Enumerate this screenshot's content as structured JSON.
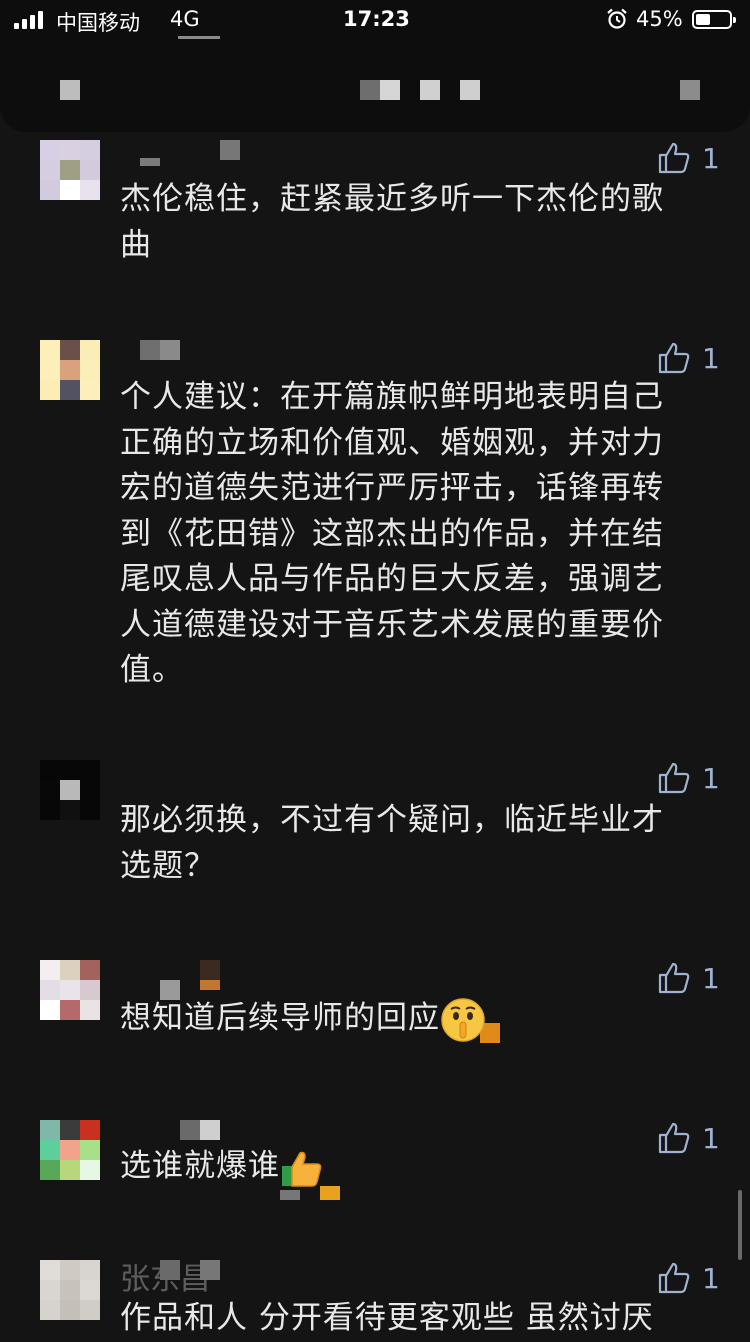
{
  "status_bar": {
    "carrier": "中国移动",
    "network": "4G",
    "time": "17:23",
    "battery_percent": "45%",
    "battery_level": 0.45
  },
  "header": {
    "title": "(pixelated)"
  },
  "comments": [
    {
      "text": "杰伦稳住，赶紧最近多听一下杰伦的歌曲",
      "likes": "1"
    },
    {
      "text": "个人建议：在开篇旗帜鲜明地表明自己正确的立场和价值观、婚姻观，并对力宏的道德失范进行严厉抨击，话锋再转到《花田错》这部杰出的作品，并在结尾叹息人品与作品的巨大反差，强调艺人道德建设对于音乐艺术发展的重要价值。",
      "likes": "1"
    },
    {
      "text": "那必须换，不过有个疑问，临近毕业才选题？",
      "likes": "1"
    },
    {
      "text": "想知道后续导师的回应",
      "emoji": "shushing-face-icon",
      "likes": "1"
    },
    {
      "text": "选谁就爆谁",
      "emoji": "thumbs-up-icon",
      "likes": "1"
    },
    {
      "author": "张东昌",
      "text": "作品和人 分开看待更客观些 虽然讨厌",
      "likes": "1"
    }
  ],
  "colors": {
    "background": "#141414",
    "text": "#e8e8e8",
    "like_icon": "#9fb3d1"
  }
}
